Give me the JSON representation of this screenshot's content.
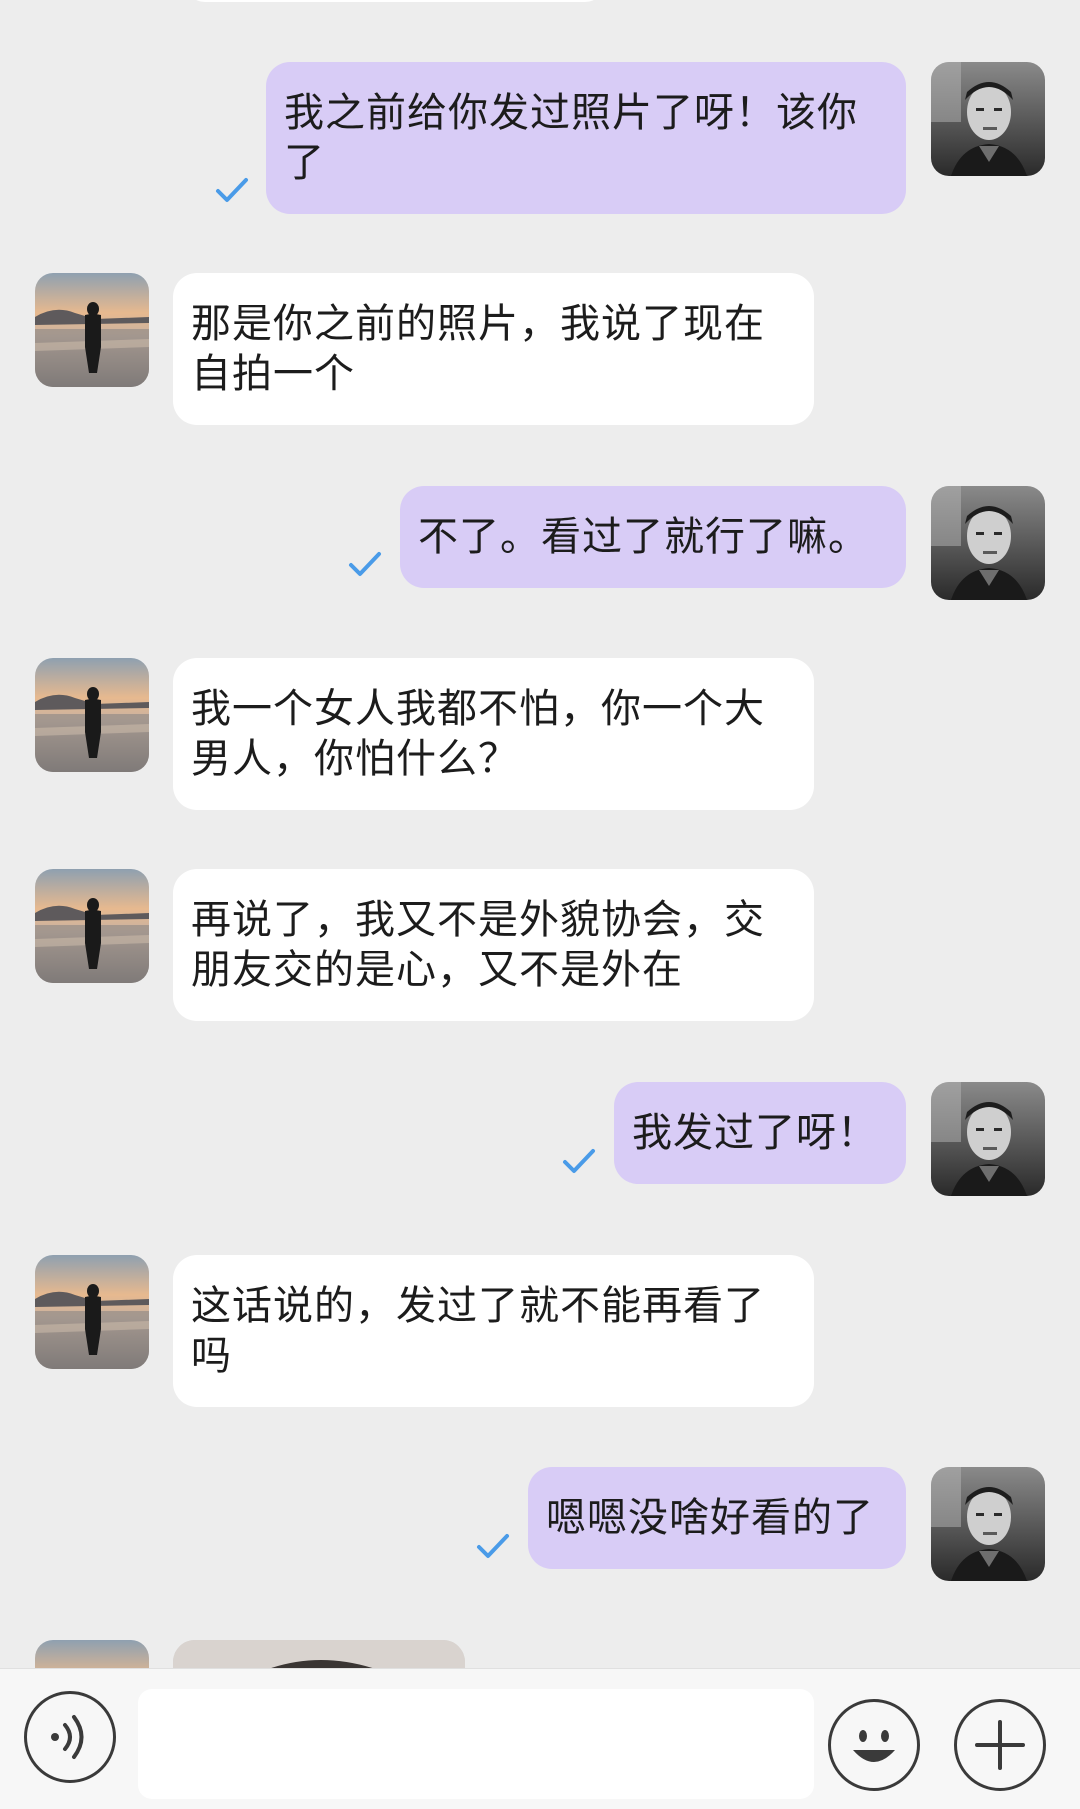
{
  "messages": [
    {
      "side": "out",
      "text": "我之前给你发过照片了呀！该你了",
      "read": true
    },
    {
      "side": "in",
      "text": "那是你之前的照片，我说了现在自拍一个"
    },
    {
      "side": "out",
      "text": "不了。看过了就行了嘛。",
      "read": true
    },
    {
      "side": "in",
      "text": "我一个女人我都不怕，你一个大男人，你怕什么？"
    },
    {
      "side": "in",
      "text": "再说了，我又不是外貌协会，交朋友交的是心，又不是外在"
    },
    {
      "side": "out",
      "text": "我发过了呀！",
      "read": true
    },
    {
      "side": "in",
      "text": "这话说的，发过了就不能再看了吗"
    },
    {
      "side": "out",
      "text": "嗯嗯没啥好看的了",
      "read": true
    }
  ],
  "input": {
    "value": "",
    "placeholder": ""
  },
  "icons": {
    "voice": "voice-icon",
    "emoji": "emoji-icon",
    "plus": "plus-icon",
    "read": "checkmark-icon"
  },
  "colors": {
    "outgoing_bubble": "#d8ccf6",
    "incoming_bubble": "#ffffff",
    "background": "#ededed",
    "checkmark": "#4a9be8"
  }
}
